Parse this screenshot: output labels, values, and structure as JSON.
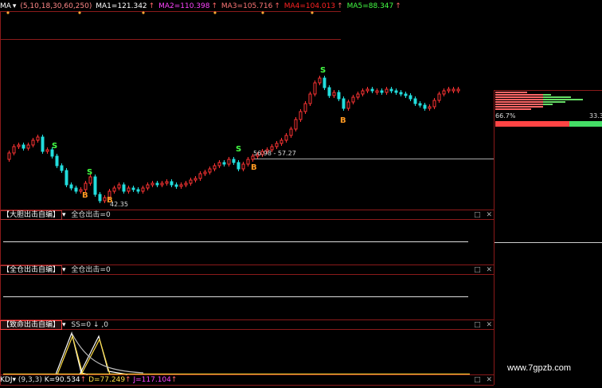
{
  "main_chart": {
    "indicator_name": "MA",
    "params": "(5,10,18,30,60,250)",
    "ma_values": [
      {
        "label": "MA1=121.342",
        "color": "#ffffff"
      },
      {
        "label": "MA2=110.398",
        "color": "#ff44ff"
      },
      {
        "label": "MA3=105.716",
        "color": "#ff7777"
      },
      {
        "label": "MA4=104.013",
        "color": "#ff2222"
      },
      {
        "label": "MA5=88.347",
        "color": "#44ff44"
      }
    ],
    "annotations": {
      "low_price": "42.35",
      "price_range": "56.98 - 57.27",
      "s_marker": "S",
      "b_marker": "B"
    }
  },
  "chip_panel": {
    "left_pct": "66.7%",
    "right_pct": "33.3"
  },
  "panels": [
    {
      "name": "【大胆出击自编】",
      "formula": "全仓出击=0"
    },
    {
      "name": "【全仓出击自编】",
      "formula": "全仓出击=0"
    },
    {
      "name": "【致命出击自编】",
      "formula": "SS=0 ↓ ,0"
    }
  ],
  "kdj": {
    "name": "KDJ",
    "params": "(9,3,3)",
    "k": "K=90.534",
    "d": "D=77.249",
    "j": "J=117.104"
  },
  "window_buttons": "□ ✕",
  "watermark": "www.7gpzb.com",
  "colors": {
    "rise": "#ff3333",
    "fall": "#22dddd",
    "border": "#8b1a1a",
    "s_marker": "#44ff44",
    "b_marker": "#ff9922"
  }
}
